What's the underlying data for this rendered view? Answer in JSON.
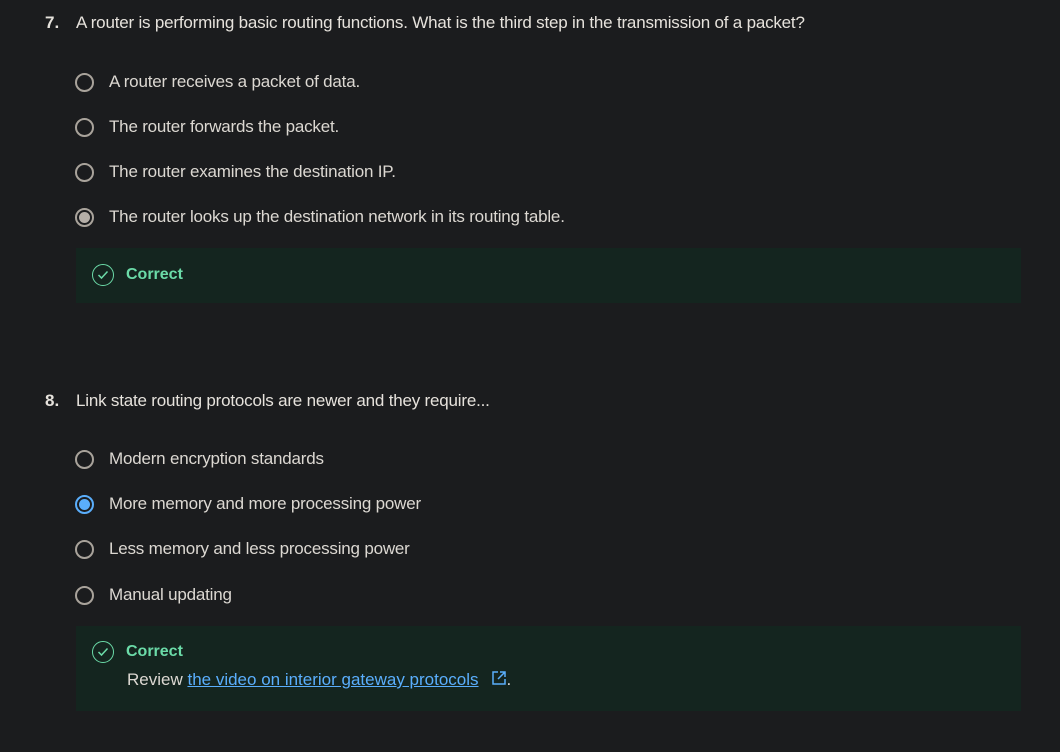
{
  "questions": [
    {
      "number": "7.",
      "text": "A router is performing basic routing functions. What is the third step in the transmission of a packet?",
      "options": [
        {
          "label": "A router receives a packet of data.",
          "selected": false
        },
        {
          "label": "The router forwards the packet.",
          "selected": false
        },
        {
          "label": "The router examines the destination IP.",
          "selected": false
        },
        {
          "label": "The router looks up the destination network in its routing table.",
          "selected": true
        }
      ],
      "feedback": {
        "title": "Correct"
      }
    },
    {
      "number": "8.",
      "text": "Link state routing protocols are newer and they require...",
      "options": [
        {
          "label": "Modern encryption standards",
          "selected": false
        },
        {
          "label": "More memory and more processing power",
          "selected": true
        },
        {
          "label": "Less memory and less processing power",
          "selected": false
        },
        {
          "label": "Manual updating",
          "selected": false
        }
      ],
      "feedback": {
        "title": "Correct",
        "review_prefix": "Review ",
        "link_text": "the video on interior gateway protocols",
        "suffix": "."
      }
    }
  ],
  "colors": {
    "background": "#1b1c1e",
    "feedback_bg": "#14251f",
    "correct": "#6bdba8",
    "link": "#5aaefc"
  }
}
